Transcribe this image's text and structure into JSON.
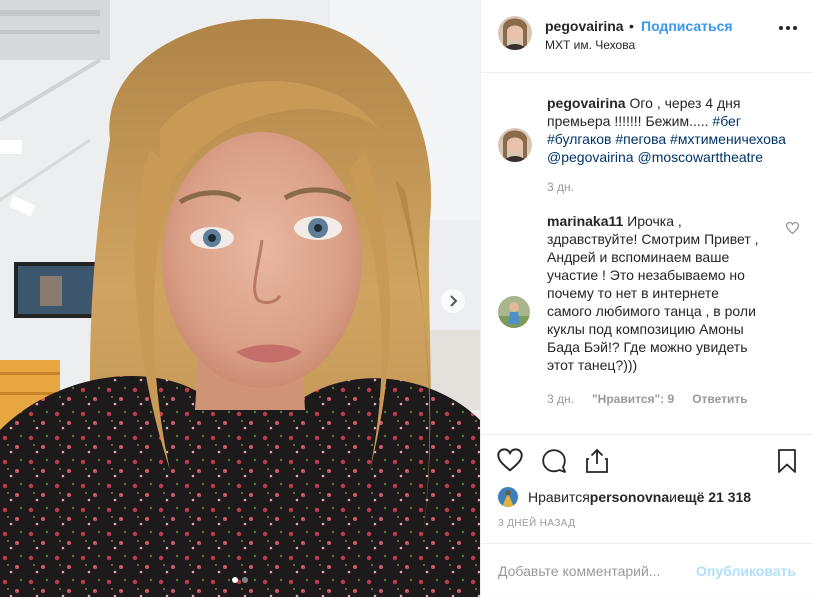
{
  "post": {
    "username": "pegovairina",
    "separator": "•",
    "follow_label": "Подписаться",
    "location": "МХТ им. Чехова",
    "caption": {
      "username": "pegovairina",
      "text_before": " Ого , через 4 дня премьера !!!!!!! Бежим..... ",
      "tags": [
        "#бег",
        "#булгаков",
        "#пегова",
        "#мхтименичехова",
        "@pegovairina",
        "@moscowarttheatre"
      ],
      "time": "3 дн."
    },
    "comment": {
      "username": "marinaka11",
      "text": " Ирочка , здравствуйте! Смотрим Привет , Андрей и вспоминаем ваше участие ! Это незабываемо но почему то нет в интернете самого любимого танца , в роли куклы под композицию Амоны Бада Бэй!? Где можно увидеть этот танец?)))",
      "time": "3 дн.",
      "likes": "\"Нравится\": 9",
      "reply_label": "Ответить"
    },
    "likes": {
      "prefix": "Нравится ",
      "user": "personovna",
      "middle": " и ",
      "count": "ещё 21 318"
    },
    "date": "3 ДНЕЙ НАЗАД",
    "add_comment": {
      "placeholder": "Добавьте комментарий...",
      "publish_label": "Опубликовать"
    },
    "carousel": {
      "slides": 2,
      "active": 1
    },
    "colors": {
      "accent": "#3897f0",
      "tag": "#003569",
      "muted": "#999999",
      "publish_disabled": "#b2dffc"
    },
    "icons": [
      "heart-icon",
      "comment-icon",
      "share-icon",
      "bookmark-icon",
      "more-icon",
      "chevron-right-icon"
    ]
  }
}
